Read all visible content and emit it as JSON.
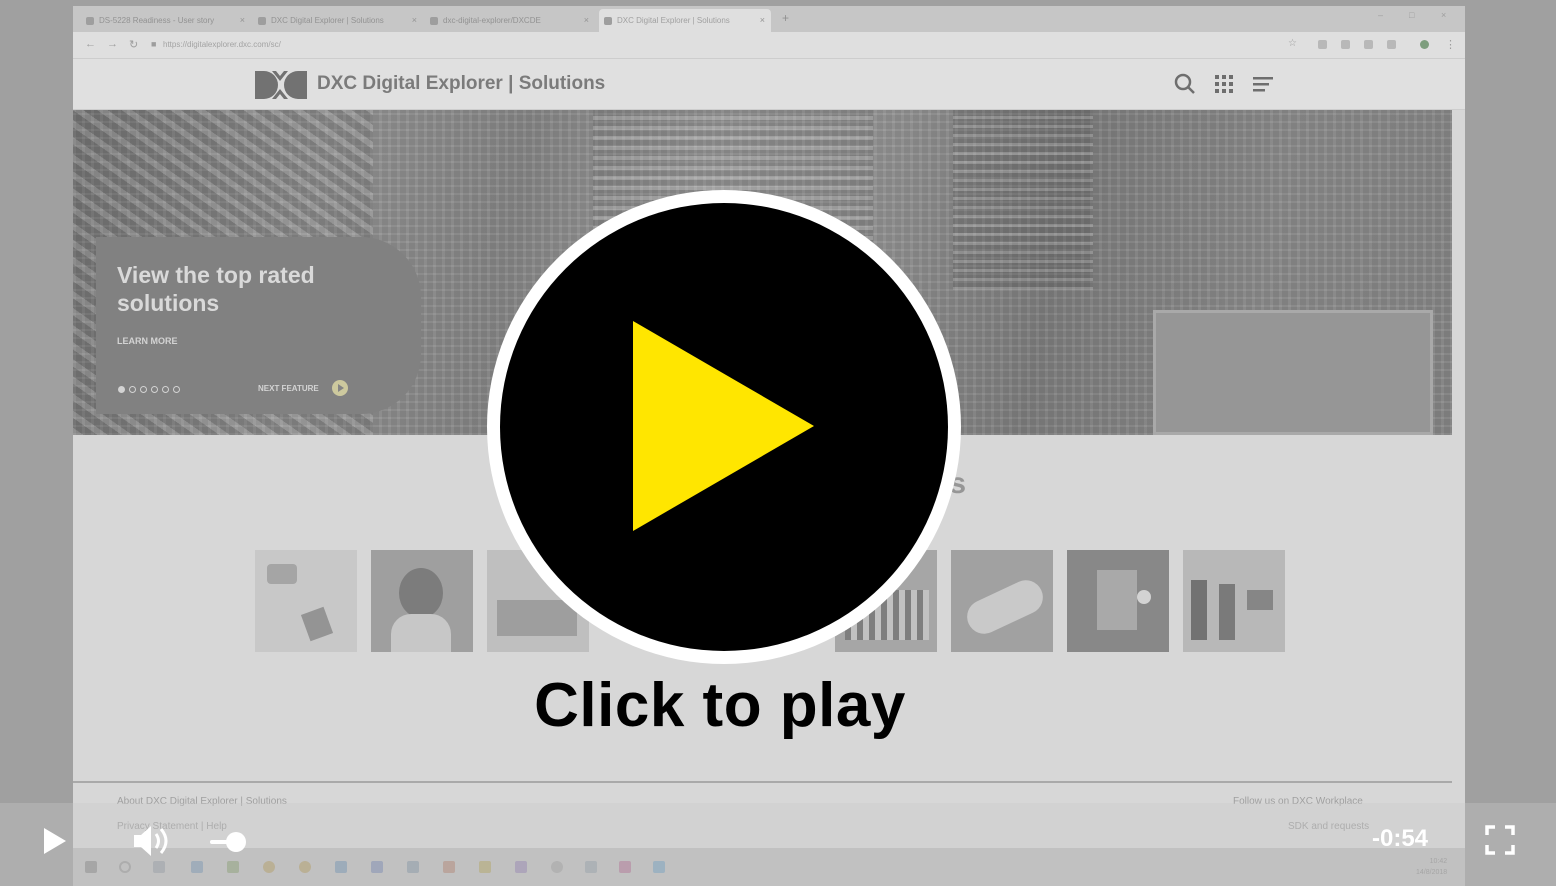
{
  "browser": {
    "tabs": [
      {
        "label": "DS-5228 Readiness - User story"
      },
      {
        "label": "DXC Digital Explorer | Solutions"
      },
      {
        "label": "dxc-digital-explorer/DXCDE"
      },
      {
        "label": "DXC Digital Explorer | Solutions"
      }
    ],
    "url": "https://digitalexplorer.dxc.com/sc/"
  },
  "site": {
    "title": "DXC Digital Explorer | Solutions"
  },
  "hero": {
    "feature_title": "View the top rated solutions",
    "learn_more": "LEARN MORE",
    "next_feature": "NEXT FEATURE"
  },
  "section": {
    "title_fragment": "ns"
  },
  "footer": {
    "about": "About DXC Digital Explorer | Solutions",
    "privacy": "Privacy Statement | Help",
    "follow": "Follow us on DXC Workplace",
    "sdk": "SDK and requests"
  },
  "taskbar": {
    "time": "10:42",
    "date": "14/8/2018"
  },
  "overlay": {
    "cta": "Click to play"
  },
  "player": {
    "time_remaining": "-0:54",
    "volume_level": 0.3
  },
  "colors": {
    "play_triangle": "#ffe600",
    "play_circle": "#000000"
  }
}
